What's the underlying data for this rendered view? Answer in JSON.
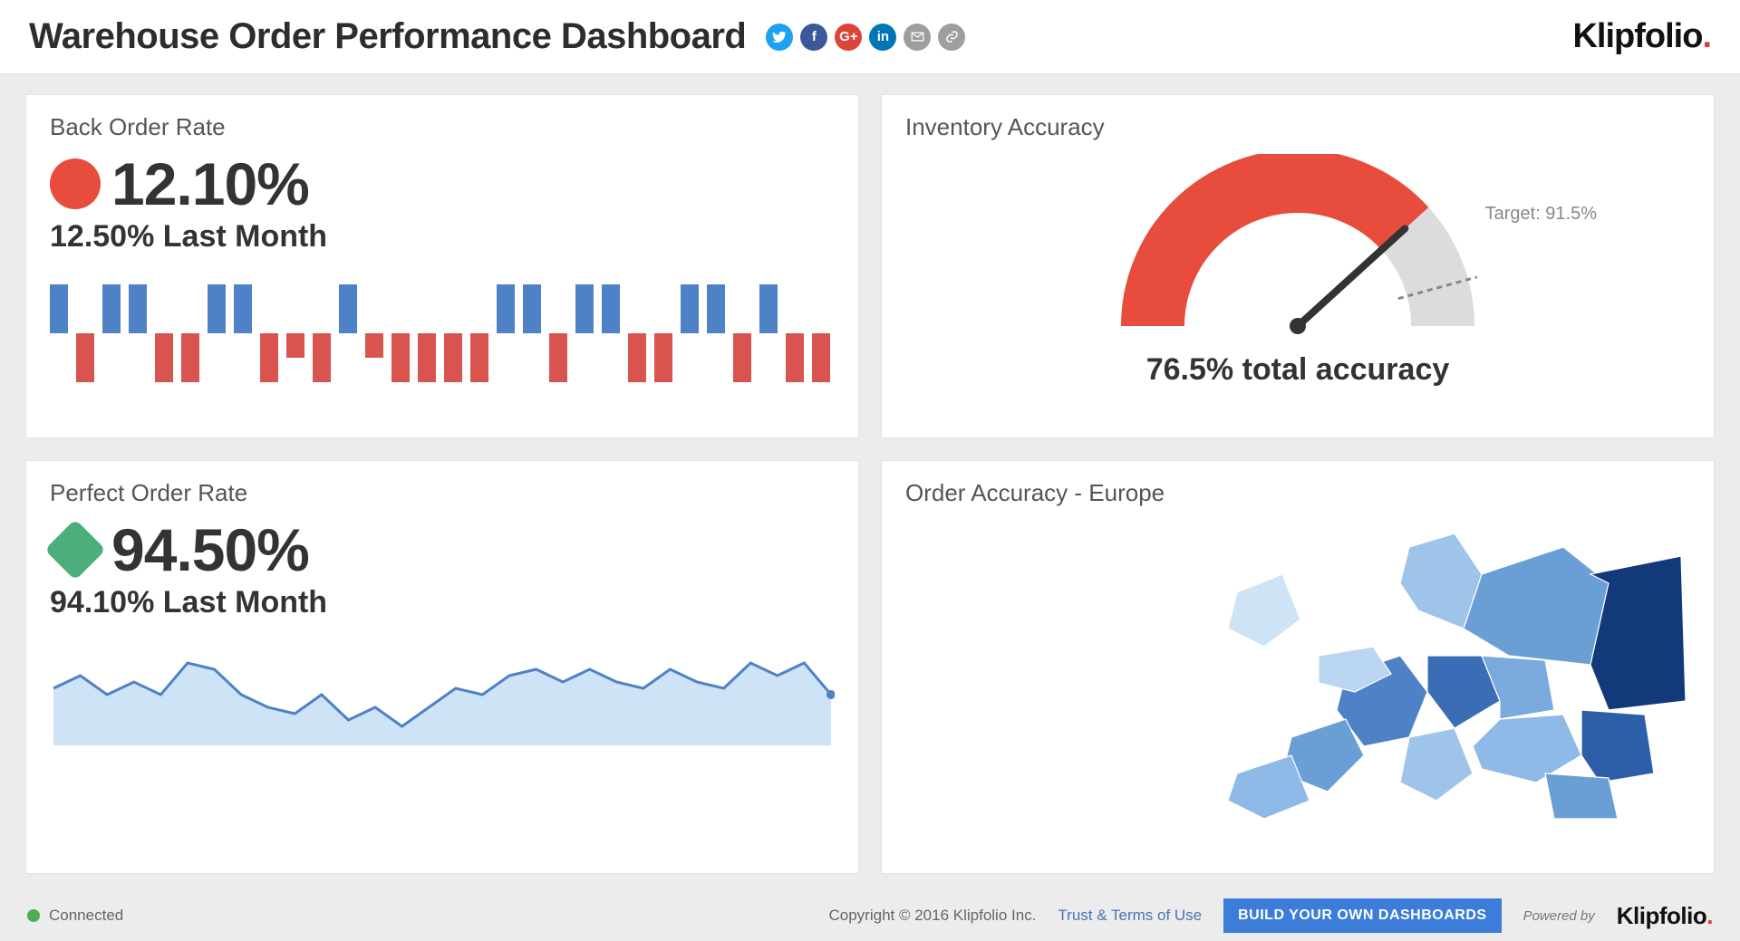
{
  "header": {
    "title": "Warehouse Order Performance Dashboard",
    "brand": "Klipfolio"
  },
  "panels": {
    "back_order": {
      "title": "Back Order Rate",
      "value": "12.10%",
      "last": "12.50% Last Month"
    },
    "perfect_order": {
      "title": "Perfect Order Rate",
      "value": "94.50%",
      "last": "94.10% Last Month"
    },
    "inventory_accuracy": {
      "title": "Inventory Accuracy",
      "target_label": "Target: 91.5%",
      "display": "76.5% total accuracy"
    },
    "order_accuracy_map": {
      "title": "Order Accuracy - Europe"
    }
  },
  "footer": {
    "status": "Connected",
    "copyright": "Copyright © 2016 Klipfolio Inc.",
    "terms": "Trust & Terms of Use",
    "cta": "BUILD YOUR OWN DASHBOARDS",
    "powered": "Powered by",
    "brand": "Klipfolio"
  },
  "chart_data": [
    {
      "type": "bar",
      "name": "Back Order Rate Win/Loss",
      "title": "Back Order Rate",
      "note": "Positive values render blue above baseline, negative render red below. Magnitudes are relative (unlabeled).",
      "values": [
        1,
        -1,
        1,
        1,
        -1,
        -1,
        1,
        1,
        -1,
        -0.5,
        -1,
        1,
        -0.5,
        -1,
        -1,
        -1,
        -1,
        1,
        1,
        -1,
        1,
        1,
        -1,
        -1,
        1,
        1,
        -1,
        1,
        -1,
        -1
      ]
    },
    {
      "type": "area",
      "name": "Perfect Order Rate Sparkline",
      "title": "Perfect Order Rate",
      "ylim": [
        90,
        98
      ],
      "x": [
        0,
        1,
        2,
        3,
        4,
        5,
        6,
        7,
        8,
        9,
        10,
        11,
        12,
        13,
        14,
        15,
        16,
        17,
        18,
        19,
        20,
        21,
        22,
        23,
        24,
        25,
        26,
        27,
        28,
        29
      ],
      "y": [
        94.5,
        95.5,
        94.0,
        95.0,
        94.0,
        96.5,
        96.0,
        94.0,
        93.0,
        92.5,
        94.0,
        92.0,
        93.0,
        91.5,
        93.0,
        94.5,
        94.0,
        95.5,
        96.0,
        95.0,
        96.0,
        95.0,
        94.5,
        96.0,
        95.0,
        94.5,
        96.5,
        95.5,
        96.5,
        94.0
      ]
    },
    {
      "type": "gauge",
      "name": "Inventory Accuracy Gauge",
      "title": "Inventory Accuracy",
      "value": 76.5,
      "target": 91.5,
      "range": [
        0,
        100
      ],
      "unit": "%"
    },
    {
      "type": "map",
      "name": "Order Accuracy - Europe Choropleth",
      "title": "Order Accuracy - Europe",
      "region": "Europe",
      "note": "Individual country values are not labeled; colors range light-blue (low) to dark-blue (high)."
    }
  ]
}
